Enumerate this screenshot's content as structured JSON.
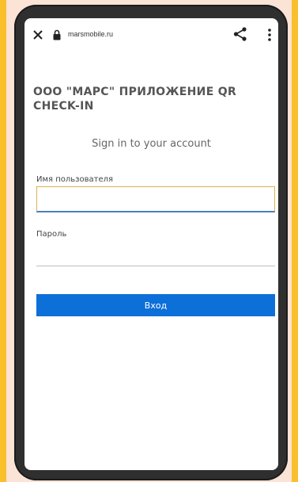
{
  "browser": {
    "url": "marsmobile.ru",
    "icons": {
      "close": "close-icon",
      "lock": "lock-icon",
      "share": "share-icon",
      "menu": "more-vert-icon"
    }
  },
  "page": {
    "title": "ООО \"МАРС\" ПРИЛОЖЕНИЕ QR CHECK-IN",
    "subtitle": "Sign in to your account",
    "username_label": "Имя пользователя",
    "username_value": "",
    "password_label": "Пароль",
    "password_value": "",
    "login_button": "Вход"
  },
  "colors": {
    "background": "#FBE3D5",
    "frame_accent": "#FAC02C",
    "device": "#2f2f2f",
    "button": "#0d6fd8"
  }
}
